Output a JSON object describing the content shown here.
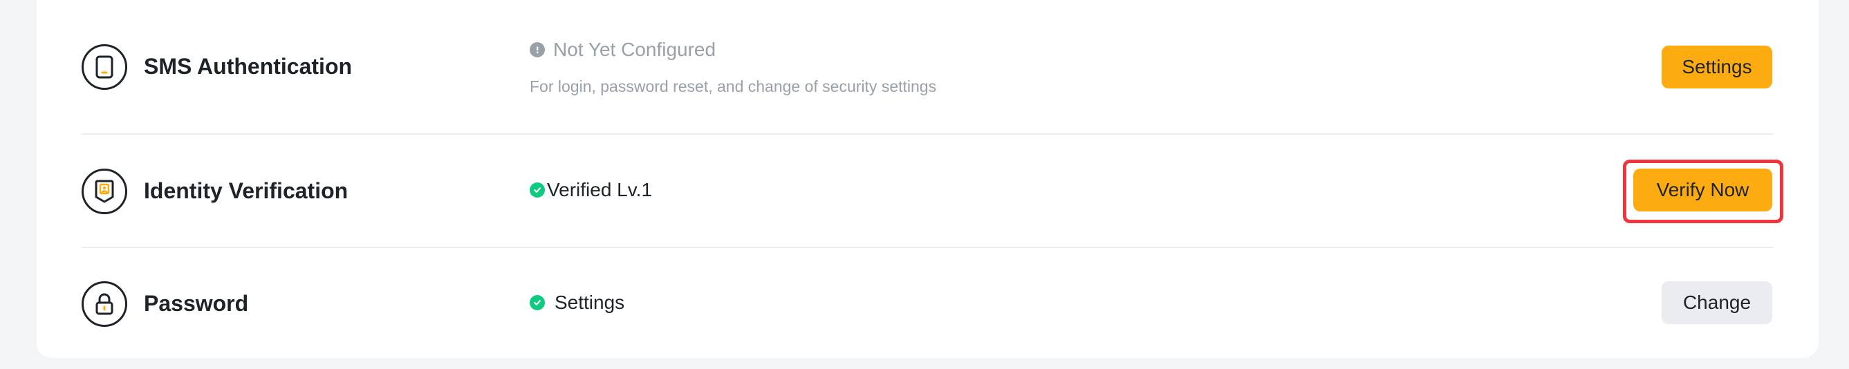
{
  "security_items": [
    {
      "title": "SMS Authentication",
      "icon": "phone-icon",
      "status": "Not Yet Configured",
      "status_color": "#9aa0a8",
      "description": "For login, password reset, and change of security settings",
      "button": "Settings",
      "button_style": "primary"
    },
    {
      "title": "Identity Verification",
      "icon": "id-badge-icon",
      "status": "Verified Lv.1",
      "status_color": "#0ecb81",
      "button": "Verify Now",
      "button_style": "primary",
      "highlighted": true
    },
    {
      "title": "Password",
      "icon": "lock-icon",
      "status": "Settings",
      "status_color": "#0ecb81",
      "button": "Change",
      "button_style": "secondary"
    }
  ],
  "colors": {
    "accent": "#fcab10",
    "success": "#0ecb81",
    "highlight": "#f0353c"
  }
}
